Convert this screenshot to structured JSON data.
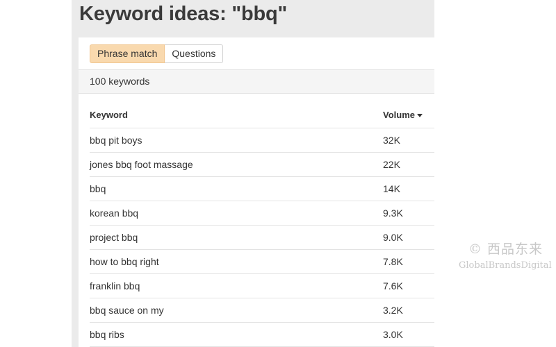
{
  "page": {
    "title": "Keyword ideas: \"bbq\""
  },
  "tabs": [
    {
      "label": "Phrase match",
      "active": true
    },
    {
      "label": "Questions",
      "active": false
    }
  ],
  "summary": {
    "count_text": "100 keywords"
  },
  "table": {
    "columns": {
      "keyword": "Keyword",
      "volume": "Volume"
    },
    "sort": {
      "column": "volume",
      "direction": "descending"
    },
    "rows": [
      {
        "keyword": "bbq pit boys",
        "volume": "32K"
      },
      {
        "keyword": "jones bbq foot massage",
        "volume": "22K"
      },
      {
        "keyword": "bbq",
        "volume": "14K"
      },
      {
        "keyword": "korean bbq",
        "volume": "9.3K"
      },
      {
        "keyword": "project bbq",
        "volume": "9.0K"
      },
      {
        "keyword": "how to bbq right",
        "volume": "7.8K"
      },
      {
        "keyword": "franklin bbq",
        "volume": "7.6K"
      },
      {
        "keyword": "bbq sauce on my",
        "volume": "3.2K"
      },
      {
        "keyword": "bbq ribs",
        "volume": "3.0K"
      }
    ]
  },
  "watermark": {
    "line1": "© 西品东来",
    "line2": "GlobalBrandsDigital"
  },
  "colors": {
    "panel_background": "#ebebeb",
    "active_tab": "#f9d9ae",
    "text": "#333333"
  }
}
